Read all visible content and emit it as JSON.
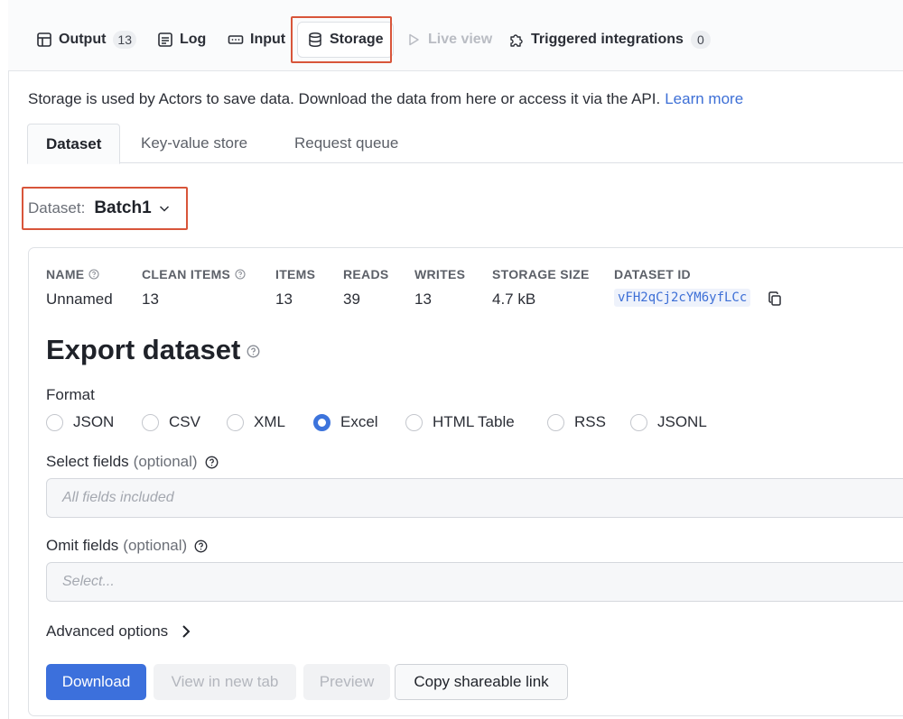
{
  "top_tabs": {
    "output": {
      "label": "Output",
      "count": "13"
    },
    "log": {
      "label": "Log"
    },
    "input": {
      "label": "Input"
    },
    "storage": {
      "label": "Storage"
    },
    "live_view": {
      "label": "Live view"
    },
    "triggered": {
      "label": "Triggered integrations",
      "count": "0"
    }
  },
  "description": {
    "text": "Storage is used by Actors to save data. Download the data from here or access it via the API.",
    "link": "Learn more"
  },
  "sub_tabs": [
    "Dataset",
    "Key-value store",
    "Request queue"
  ],
  "dataset_selector": {
    "label": "Dataset:",
    "value": "Batch1"
  },
  "meta": {
    "headers": [
      "NAME",
      "CLEAN ITEMS",
      "ITEMS",
      "READS",
      "WRITES",
      "STORAGE SIZE",
      "DATASET ID"
    ],
    "values": [
      "Unnamed",
      "13",
      "13",
      "39",
      "13",
      "4.7 kB"
    ],
    "dataset_id": "vFH2qCj2cYM6yfLCc"
  },
  "export": {
    "title": "Export dataset",
    "format_label": "Format",
    "formats": [
      "JSON",
      "CSV",
      "XML",
      "Excel",
      "HTML Table",
      "RSS",
      "JSONL"
    ],
    "selected_format": "Excel",
    "select_fields": {
      "label": "Select fields",
      "optional": "(optional)",
      "placeholder": "All fields included"
    },
    "omit_fields": {
      "label": "Omit fields",
      "optional": "(optional)",
      "placeholder": "Select..."
    },
    "advanced": "Advanced options"
  },
  "buttons": {
    "download": "Download",
    "view_new_tab": "View in new tab",
    "preview": "Preview",
    "copy_link": "Copy shareable link"
  },
  "colors": {
    "accent": "#3c70dc",
    "highlight": "#d8553a",
    "link": "#3d6fd6"
  }
}
